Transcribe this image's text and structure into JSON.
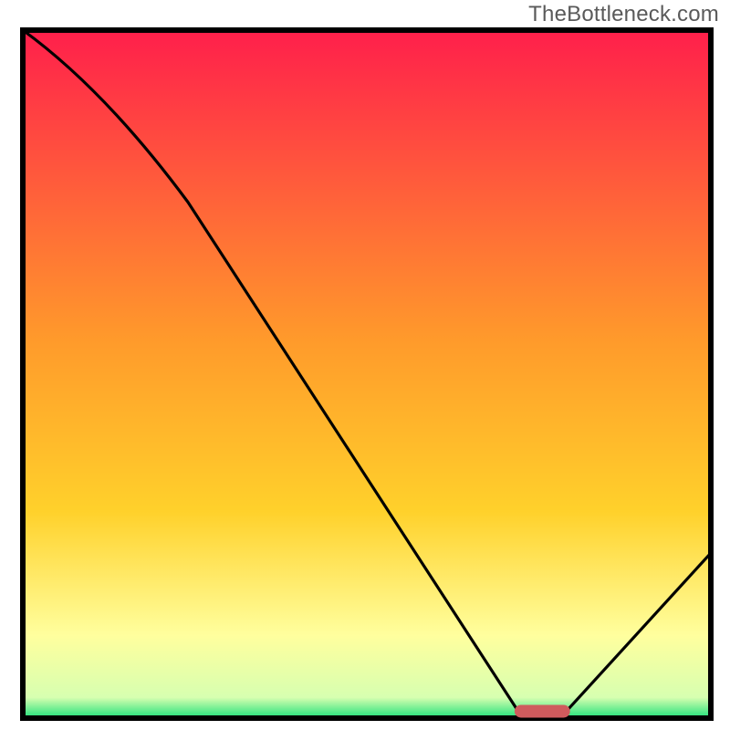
{
  "attribution": "TheBottleneck.com",
  "chart_data": {
    "type": "line",
    "title": "",
    "xlabel": "",
    "ylabel": "",
    "xlim": [
      0,
      100
    ],
    "ylim": [
      0,
      100
    ],
    "series": [
      {
        "name": "bottleneck-curve",
        "x": [
          0,
          24,
          72,
          79,
          100
        ],
        "values": [
          100,
          75,
          1,
          1,
          24
        ]
      }
    ],
    "optimal_marker": {
      "x_start": 72,
      "x_end": 79,
      "y": 1
    }
  },
  "colors": {
    "gradient_top": "#ff1f4b",
    "gradient_mid": "#ffd12b",
    "gradient_low": "#ffff9e",
    "gradient_base": "#1ee07a",
    "frame": "#000000",
    "curve": "#000000",
    "marker": "#cf5b5d"
  }
}
